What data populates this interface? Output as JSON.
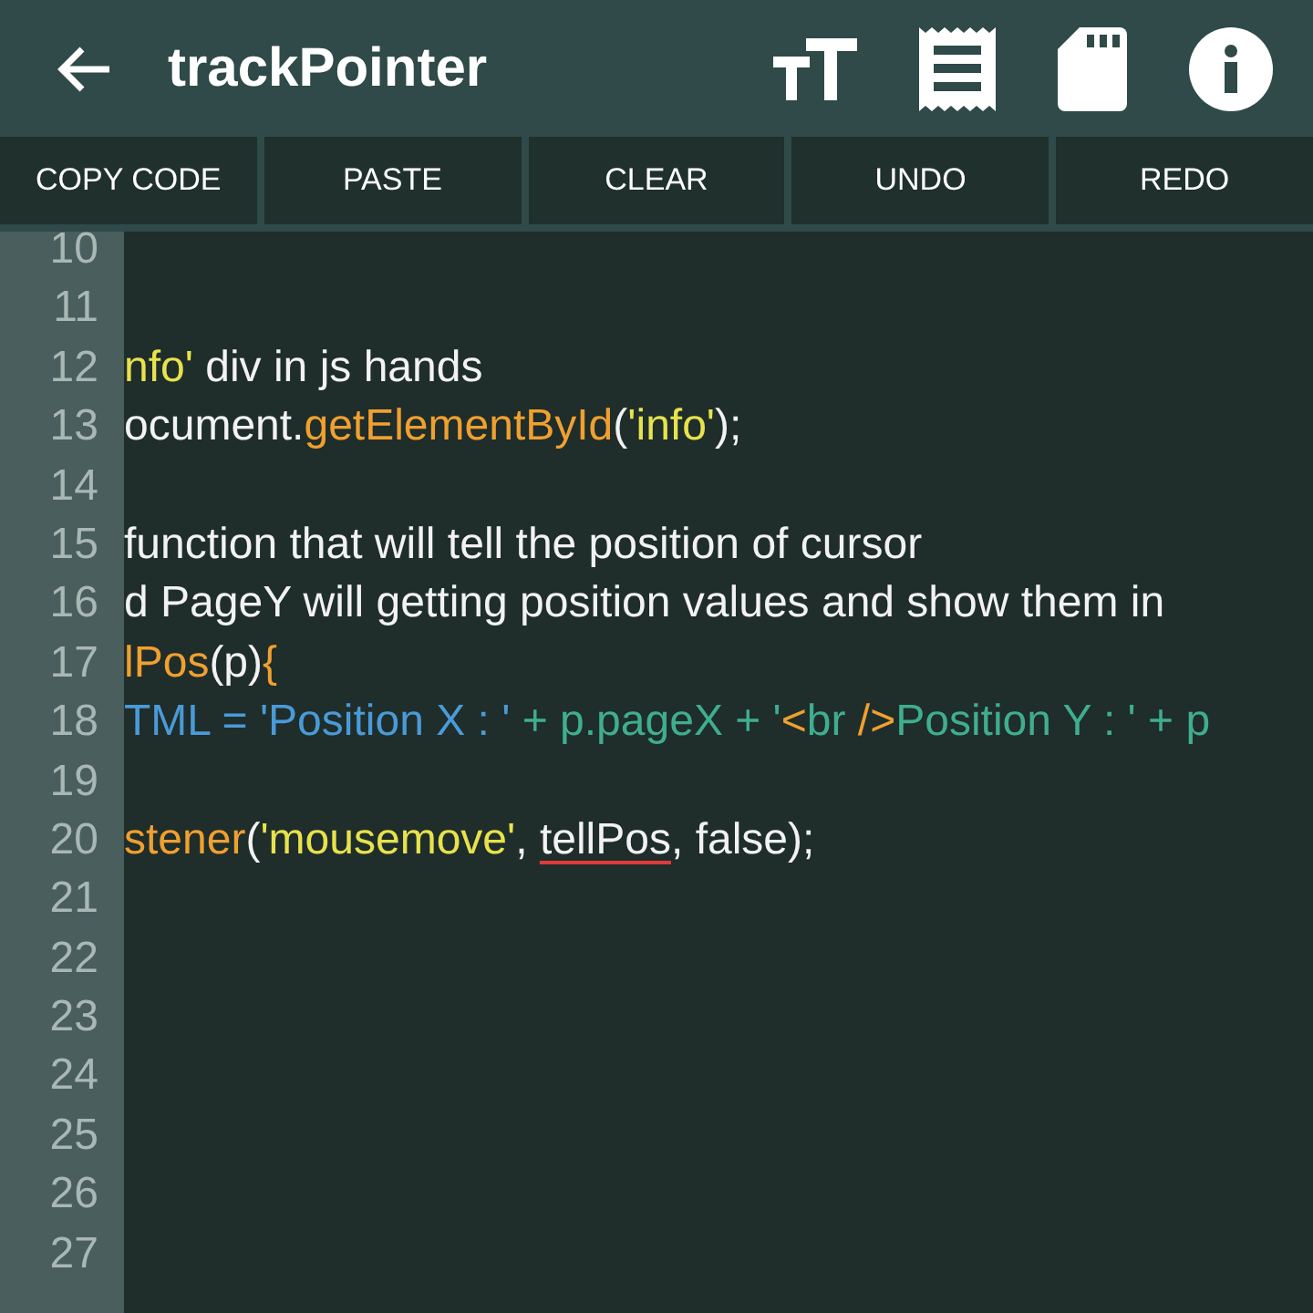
{
  "app_bar": {
    "title": "trackPointer"
  },
  "toolbar": [
    "COPY CODE",
    "PASTE",
    "CLEAR",
    "UNDO",
    "REDO"
  ],
  "editor": {
    "lines": [
      {
        "number": "10"
      },
      {
        "number": "11"
      },
      {
        "number": "12",
        "tokens": [
          {
            "text": "nfo'",
            "kind": "string"
          },
          {
            "text": " div in js hands",
            "kind": "plain"
          }
        ]
      },
      {
        "number": "13",
        "tokens": [
          {
            "text": "ocument.",
            "kind": "plain"
          },
          {
            "text": "getElementById",
            "kind": "function"
          },
          {
            "text": "(",
            "kind": "plain"
          },
          {
            "text": "'info'",
            "kind": "string"
          },
          {
            "text": ");",
            "kind": "plain"
          }
        ]
      },
      {
        "number": "14"
      },
      {
        "number": "15",
        "tokens": [
          {
            "text": "function that will tell the position of cursor",
            "kind": "plain"
          }
        ]
      },
      {
        "number": "16",
        "tokens": [
          {
            "text": "d PageY will getting position values and show them in",
            "kind": "plain"
          }
        ]
      },
      {
        "number": "17",
        "tokens": [
          {
            "text": "lPos",
            "kind": "function"
          },
          {
            "text": "(p)",
            "kind": "plain"
          },
          {
            "text": "{",
            "kind": "function"
          }
        ]
      },
      {
        "number": "18",
        "tokens": [
          {
            "text": "TML = 'Position X : '",
            "kind": "property"
          },
          {
            "text": " + p.pageX + '",
            "kind": "markup"
          },
          {
            "text": "<",
            "kind": "function"
          },
          {
            "text": "br ",
            "kind": "markup"
          },
          {
            "text": "/>",
            "kind": "function"
          },
          {
            "text": "Position Y : ' + p",
            "kind": "markup"
          }
        ]
      },
      {
        "number": "19"
      },
      {
        "number": "20",
        "tokens": [
          {
            "text": "stener",
            "kind": "function"
          },
          {
            "text": "(",
            "kind": "plain"
          },
          {
            "text": "'mousemove'",
            "kind": "string"
          },
          {
            "text": ", ",
            "kind": "plain"
          },
          {
            "text": "tellPos",
            "kind": "plain",
            "flagged": true
          },
          {
            "text": ", false);",
            "kind": "plain"
          }
        ]
      },
      {
        "number": "21"
      },
      {
        "number": "22"
      },
      {
        "number": "23"
      },
      {
        "number": "24"
      },
      {
        "number": "25"
      },
      {
        "number": "26"
      },
      {
        "number": "27"
      }
    ]
  }
}
